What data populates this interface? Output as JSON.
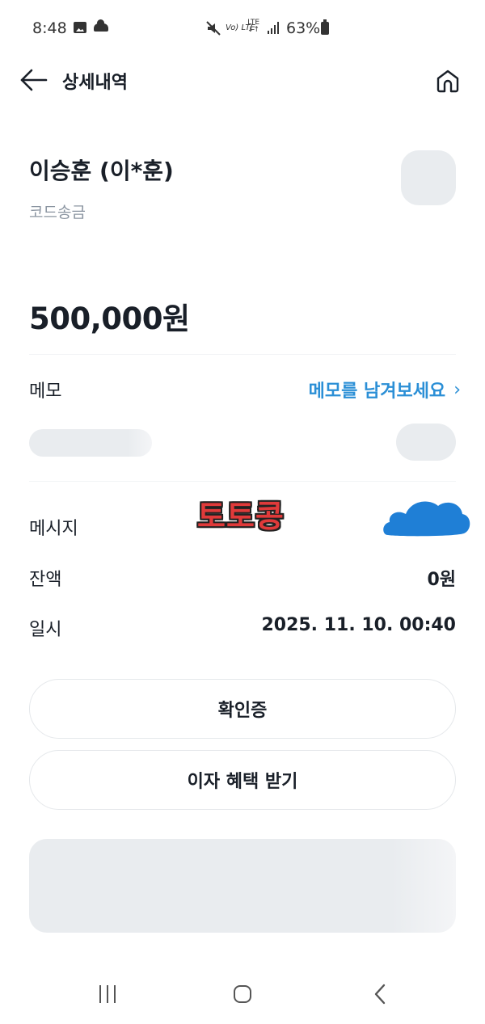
{
  "status_bar": {
    "time": "8:48",
    "volte": "Vo) LTE",
    "lte_top": "LTE",
    "lte_bottom": "↓↑",
    "battery": "63%"
  },
  "header": {
    "title": "상세내역",
    "back_icon": "arrow-left-icon",
    "home_icon": "home-icon"
  },
  "recipient": {
    "name": "이승훈 (이*훈)",
    "type": "코드송금"
  },
  "amount": "500,000원",
  "memo": {
    "label": "메모",
    "link": "메모를 남겨보세요",
    "chevron": "›"
  },
  "watermark": "토토콩",
  "details": [
    {
      "label": "메시지",
      "value": ""
    },
    {
      "label": "잔액",
      "value": "0원"
    },
    {
      "label": "일시",
      "value": "2025. 11. 10. 00:40"
    }
  ],
  "buttons": {
    "certificate": "확인증",
    "interest": "이자 혜택 받기"
  },
  "colors": {
    "link": "#2b8fd6",
    "watermark": "#e03a3a",
    "blob": "#1f7fd6"
  }
}
